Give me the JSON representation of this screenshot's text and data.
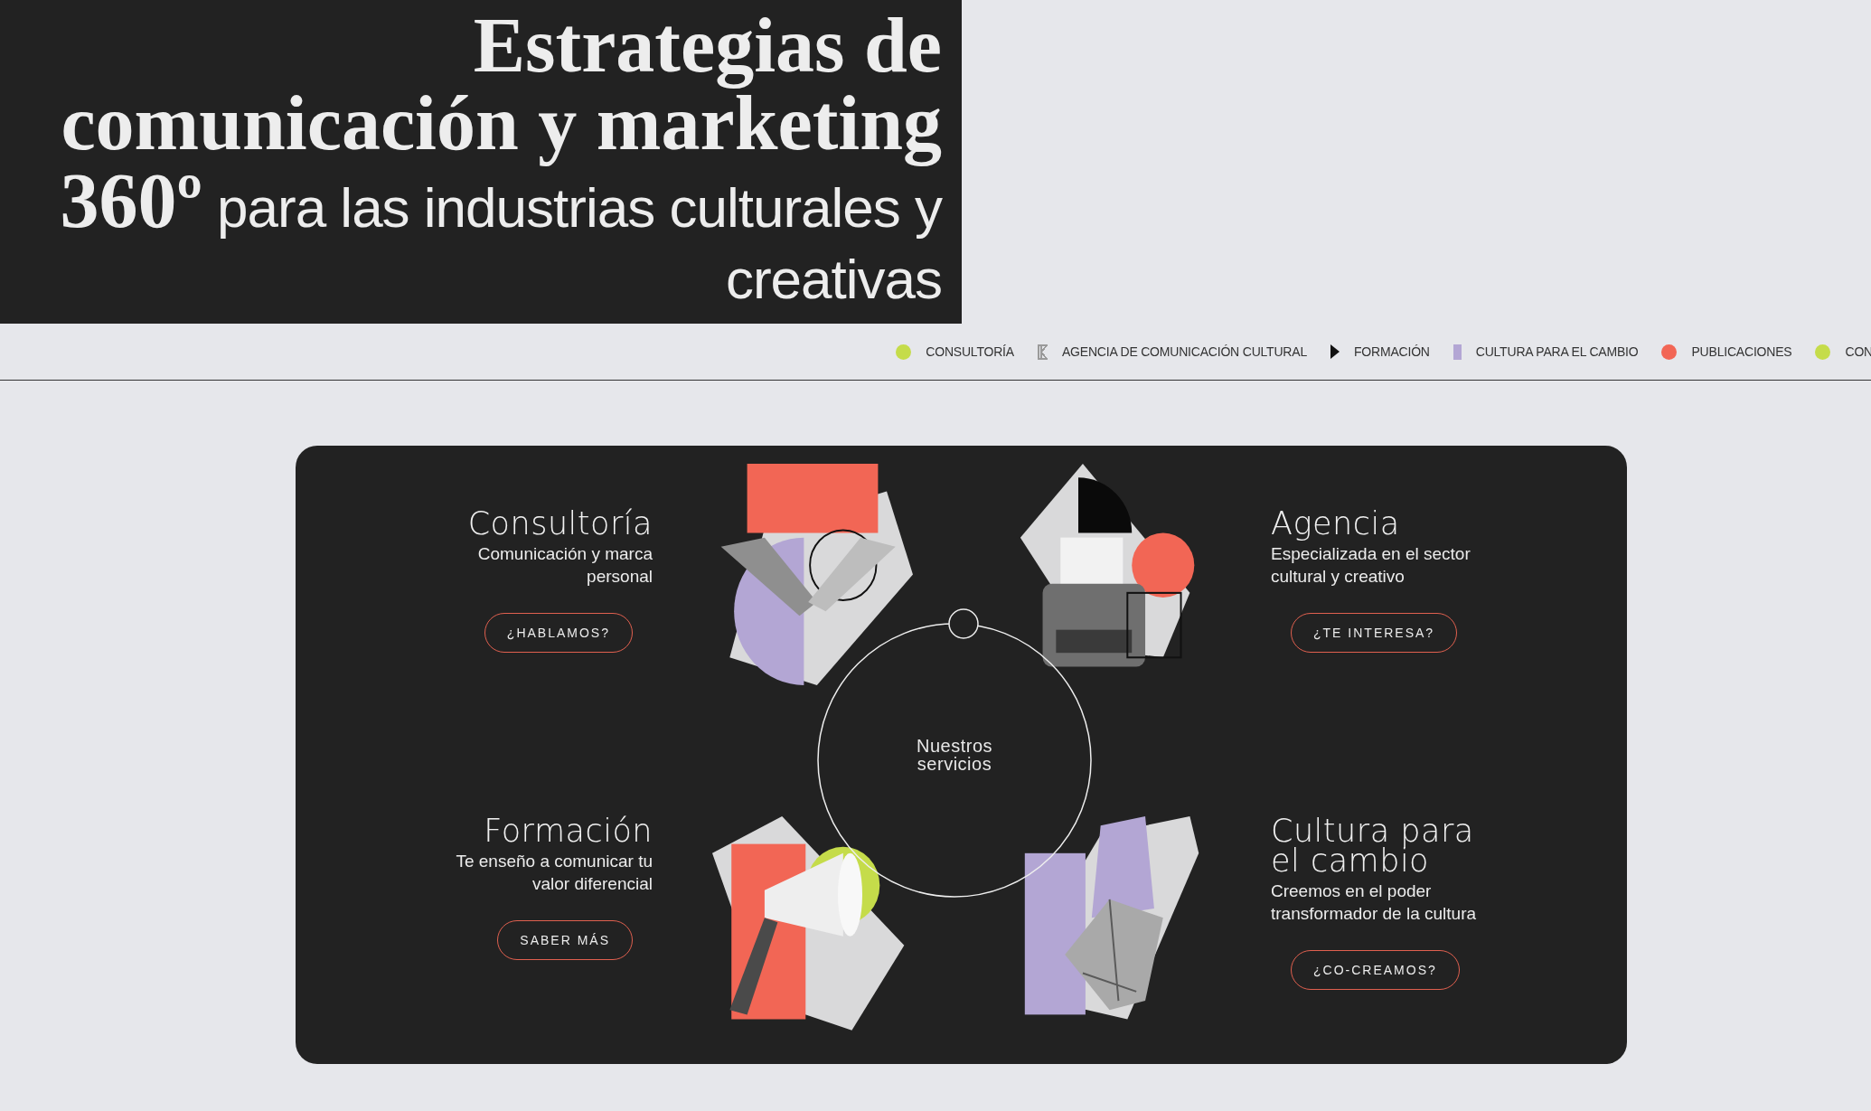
{
  "headline": {
    "bold": "Estrategias de comunicación y marketing 360º",
    "light": "para las industrias culturales y creativas"
  },
  "ticker": [
    {
      "label": "CONSULTORÍA",
      "kind": "dot",
      "color": "#c5dc4a"
    },
    {
      "label": "AGENCIA DE COMUNICACIÓN CULTURAL",
      "kind": "bracket",
      "color": "#9a9a9a"
    },
    {
      "label": "FORMACIÓN",
      "kind": "triangle",
      "color": "#111111"
    },
    {
      "label": "CULTURA PARA EL CAMBIO",
      "kind": "bar",
      "color": "#b3a6d4"
    },
    {
      "label": "PUBLICACIONES",
      "kind": "dot",
      "color": "#f26655"
    },
    {
      "label": "CON",
      "kind": "dot",
      "color": "#c5dc4a"
    }
  ],
  "services_label": "Nuestros servicios",
  "services": [
    {
      "title": "Consultoría",
      "text": "Comunicación y marca personal",
      "button": "¿HABLAMOS?"
    },
    {
      "title": "Agencia",
      "text": "Especializada en el sector cultural y creativo",
      "button": "¿TE INTERESA?"
    },
    {
      "title": "Formación",
      "text": "Te enseño a comunicar tu valor diferencial",
      "button": "SABER MÁS"
    },
    {
      "title": "Cultura para el cambio",
      "text": "Creemos en el poder transformador de la cultura",
      "button": "¿CO-CREAMOS?"
    }
  ]
}
